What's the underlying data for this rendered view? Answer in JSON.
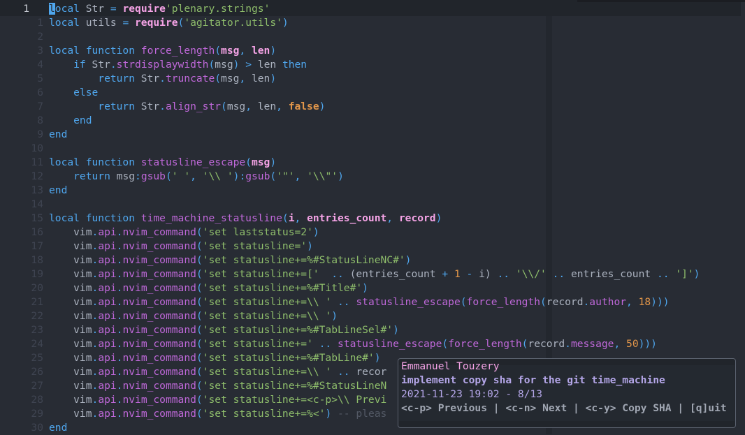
{
  "editor": {
    "cursor_line_number": "1",
    "lines": [
      {
        "num": "1",
        "current": true
      },
      {
        "num": "1"
      },
      {
        "num": "2"
      },
      {
        "num": "3"
      },
      {
        "num": "4"
      },
      {
        "num": "5"
      },
      {
        "num": "6"
      },
      {
        "num": "7"
      },
      {
        "num": "8"
      },
      {
        "num": "9"
      },
      {
        "num": "10"
      },
      {
        "num": "11"
      },
      {
        "num": "12"
      },
      {
        "num": "13"
      },
      {
        "num": "14"
      },
      {
        "num": "15"
      },
      {
        "num": "16"
      },
      {
        "num": "17"
      },
      {
        "num": "18"
      },
      {
        "num": "19"
      },
      {
        "num": "20"
      },
      {
        "num": "21"
      },
      {
        "num": "22"
      },
      {
        "num": "23"
      },
      {
        "num": "24"
      },
      {
        "num": "25"
      },
      {
        "num": "26"
      },
      {
        "num": "27"
      },
      {
        "num": "28"
      },
      {
        "num": "29"
      },
      {
        "num": "30"
      }
    ],
    "code": [
      [
        [
          "cursor",
          "l"
        ],
        [
          "kw",
          "ocal "
        ],
        [
          "id",
          "Str "
        ],
        [
          "op",
          "= "
        ],
        [
          "req",
          "require"
        ],
        [
          "str",
          "'plenary.strings'"
        ]
      ],
      [
        [
          "kw",
          "local "
        ],
        [
          "id",
          "utils "
        ],
        [
          "op",
          "= "
        ],
        [
          "req",
          "require"
        ],
        [
          "punc",
          "("
        ],
        [
          "str",
          "'agitator.utils'"
        ],
        [
          "punc",
          ")"
        ]
      ],
      [],
      [
        [
          "kw",
          "local function "
        ],
        [
          "fn",
          "force_length"
        ],
        [
          "punc",
          "("
        ],
        [
          "param",
          "msg"
        ],
        [
          "punc",
          ", "
        ],
        [
          "param",
          "len"
        ],
        [
          "punc",
          ")"
        ]
      ],
      [
        [
          "kw",
          "    if "
        ],
        [
          "id",
          "Str"
        ],
        [
          "punc",
          "."
        ],
        [
          "fn",
          "strdisplaywidth"
        ],
        [
          "punc",
          "("
        ],
        [
          "id",
          "msg"
        ],
        [
          "punc",
          ") "
        ],
        [
          "op",
          "> "
        ],
        [
          "id",
          "len "
        ],
        [
          "kw",
          "then"
        ]
      ],
      [
        [
          "kw",
          "        return "
        ],
        [
          "id",
          "Str"
        ],
        [
          "punc",
          "."
        ],
        [
          "fn",
          "truncate"
        ],
        [
          "punc",
          "("
        ],
        [
          "id",
          "msg"
        ],
        [
          "punc",
          ", "
        ],
        [
          "id",
          "len"
        ],
        [
          "punc",
          ")"
        ]
      ],
      [
        [
          "kw",
          "    else"
        ]
      ],
      [
        [
          "kw",
          "        return "
        ],
        [
          "id",
          "Str"
        ],
        [
          "punc",
          "."
        ],
        [
          "fn",
          "align_str"
        ],
        [
          "punc",
          "("
        ],
        [
          "id",
          "msg"
        ],
        [
          "punc",
          ", "
        ],
        [
          "id",
          "len"
        ],
        [
          "punc",
          ", "
        ],
        [
          "bool",
          "false"
        ],
        [
          "punc",
          ")"
        ]
      ],
      [
        [
          "kw",
          "    end"
        ]
      ],
      [
        [
          "kw",
          "end"
        ]
      ],
      [],
      [
        [
          "kw",
          "local function "
        ],
        [
          "fn",
          "statusline_escape"
        ],
        [
          "punc",
          "("
        ],
        [
          "param",
          "msg"
        ],
        [
          "punc",
          ")"
        ]
      ],
      [
        [
          "kw",
          "    return "
        ],
        [
          "id",
          "msg"
        ],
        [
          "punc",
          ":"
        ],
        [
          "fn",
          "gsub"
        ],
        [
          "punc",
          "("
        ],
        [
          "str",
          "' '"
        ],
        [
          "punc",
          ", "
        ],
        [
          "str",
          "'\\\\ '"
        ],
        [
          "punc",
          ")"
        ],
        [
          "punc",
          ":"
        ],
        [
          "fn",
          "gsub"
        ],
        [
          "punc",
          "("
        ],
        [
          "str",
          "'\"'"
        ],
        [
          "punc",
          ", "
        ],
        [
          "str",
          "'\\\\\"'"
        ],
        [
          "punc",
          ")"
        ]
      ],
      [
        [
          "kw",
          "end"
        ]
      ],
      [],
      [
        [
          "kw",
          "local function "
        ],
        [
          "fn",
          "time_machine_statusline"
        ],
        [
          "punc",
          "("
        ],
        [
          "param",
          "i"
        ],
        [
          "punc",
          ", "
        ],
        [
          "param",
          "entries_count"
        ],
        [
          "punc",
          ", "
        ],
        [
          "param",
          "record"
        ],
        [
          "punc",
          ")"
        ]
      ],
      [
        [
          "id",
          "    vim"
        ],
        [
          "punc",
          "."
        ],
        [
          "fn",
          "api"
        ],
        [
          "punc",
          "."
        ],
        [
          "fn",
          "nvim_command"
        ],
        [
          "punc",
          "("
        ],
        [
          "str",
          "'set laststatus=2'"
        ],
        [
          "punc",
          ")"
        ]
      ],
      [
        [
          "id",
          "    vim"
        ],
        [
          "punc",
          "."
        ],
        [
          "fn",
          "api"
        ],
        [
          "punc",
          "."
        ],
        [
          "fn",
          "nvim_command"
        ],
        [
          "punc",
          "("
        ],
        [
          "str",
          "'set statusline='"
        ],
        [
          "punc",
          ")"
        ]
      ],
      [
        [
          "id",
          "    vim"
        ],
        [
          "punc",
          "."
        ],
        [
          "fn",
          "api"
        ],
        [
          "punc",
          "."
        ],
        [
          "fn",
          "nvim_command"
        ],
        [
          "punc",
          "("
        ],
        [
          "str",
          "'set statusline+=%#StatusLineNC#'"
        ],
        [
          "punc",
          ")"
        ]
      ],
      [
        [
          "id",
          "    vim"
        ],
        [
          "punc",
          "."
        ],
        [
          "fn",
          "api"
        ],
        [
          "punc",
          "."
        ],
        [
          "fn",
          "nvim_command"
        ],
        [
          "punc",
          "("
        ],
        [
          "str",
          "'set statusline+=['"
        ],
        [
          "id",
          "  "
        ],
        [
          "op",
          ".."
        ],
        [
          "id",
          " (entries_count "
        ],
        [
          "op",
          "+ "
        ],
        [
          "num",
          "1 "
        ],
        [
          "op",
          "- "
        ],
        [
          "id",
          "i) "
        ],
        [
          "op",
          ".. "
        ],
        [
          "str",
          "'\\\\/'"
        ],
        [
          "op",
          " .. "
        ],
        [
          "id",
          "entries_count "
        ],
        [
          "op",
          ".. "
        ],
        [
          "str",
          "']'"
        ],
        [
          "punc",
          ")"
        ]
      ],
      [
        [
          "id",
          "    vim"
        ],
        [
          "punc",
          "."
        ],
        [
          "fn",
          "api"
        ],
        [
          "punc",
          "."
        ],
        [
          "fn",
          "nvim_command"
        ],
        [
          "punc",
          "("
        ],
        [
          "str",
          "'set statusline+=%#Title#'"
        ],
        [
          "punc",
          ")"
        ]
      ],
      [
        [
          "id",
          "    vim"
        ],
        [
          "punc",
          "."
        ],
        [
          "fn",
          "api"
        ],
        [
          "punc",
          "."
        ],
        [
          "fn",
          "nvim_command"
        ],
        [
          "punc",
          "("
        ],
        [
          "str",
          "'set statusline+=\\\\ '"
        ],
        [
          "op",
          " .. "
        ],
        [
          "fn",
          "statusline_escape"
        ],
        [
          "punc",
          "("
        ],
        [
          "fn",
          "force_length"
        ],
        [
          "punc",
          "("
        ],
        [
          "id",
          "record"
        ],
        [
          "punc",
          "."
        ],
        [
          "fn",
          "author"
        ],
        [
          "punc",
          ", "
        ],
        [
          "num",
          "18"
        ],
        [
          "punc",
          ")))"
        ]
      ],
      [
        [
          "id",
          "    vim"
        ],
        [
          "punc",
          "."
        ],
        [
          "fn",
          "api"
        ],
        [
          "punc",
          "."
        ],
        [
          "fn",
          "nvim_command"
        ],
        [
          "punc",
          "("
        ],
        [
          "str",
          "'set statusline+=\\\\ '"
        ],
        [
          "punc",
          ")"
        ]
      ],
      [
        [
          "id",
          "    vim"
        ],
        [
          "punc",
          "."
        ],
        [
          "fn",
          "api"
        ],
        [
          "punc",
          "."
        ],
        [
          "fn",
          "nvim_command"
        ],
        [
          "punc",
          "("
        ],
        [
          "str",
          "'set statusline+=%#TabLineSel#'"
        ],
        [
          "punc",
          ")"
        ]
      ],
      [
        [
          "id",
          "    vim"
        ],
        [
          "punc",
          "."
        ],
        [
          "fn",
          "api"
        ],
        [
          "punc",
          "."
        ],
        [
          "fn",
          "nvim_command"
        ],
        [
          "punc",
          "("
        ],
        [
          "str",
          "'set statusline+='"
        ],
        [
          "op",
          " .. "
        ],
        [
          "fn",
          "statusline_escape"
        ],
        [
          "punc",
          "("
        ],
        [
          "fn",
          "force_length"
        ],
        [
          "punc",
          "("
        ],
        [
          "id",
          "record"
        ],
        [
          "punc",
          "."
        ],
        [
          "fn",
          "message"
        ],
        [
          "punc",
          ", "
        ],
        [
          "num",
          "50"
        ],
        [
          "punc",
          ")))"
        ]
      ],
      [
        [
          "id",
          "    vim"
        ],
        [
          "punc",
          "."
        ],
        [
          "fn",
          "api"
        ],
        [
          "punc",
          "."
        ],
        [
          "fn",
          "nvim_command"
        ],
        [
          "punc",
          "("
        ],
        [
          "str",
          "'set statusline+=%#TabLine#'"
        ],
        [
          "punc",
          ")"
        ]
      ],
      [
        [
          "id",
          "    vim"
        ],
        [
          "punc",
          "."
        ],
        [
          "fn",
          "api"
        ],
        [
          "punc",
          "."
        ],
        [
          "fn",
          "nvim_command"
        ],
        [
          "punc",
          "("
        ],
        [
          "str",
          "'set statusline+=\\\\ '"
        ],
        [
          "op",
          " .. "
        ],
        [
          "id",
          "recor"
        ]
      ],
      [
        [
          "id",
          "    vim"
        ],
        [
          "punc",
          "."
        ],
        [
          "fn",
          "api"
        ],
        [
          "punc",
          "."
        ],
        [
          "fn",
          "nvim_command"
        ],
        [
          "punc",
          "("
        ],
        [
          "str",
          "'set statusline+=%#StatusLineN"
        ]
      ],
      [
        [
          "id",
          "    vim"
        ],
        [
          "punc",
          "."
        ],
        [
          "fn",
          "api"
        ],
        [
          "punc",
          "."
        ],
        [
          "fn",
          "nvim_command"
        ],
        [
          "punc",
          "("
        ],
        [
          "str",
          "'set statusline+=<c-p>\\\\ Previ"
        ]
      ],
      [
        [
          "id",
          "    vim"
        ],
        [
          "punc",
          "."
        ],
        [
          "fn",
          "api"
        ],
        [
          "punc",
          "."
        ],
        [
          "fn",
          "nvim_command"
        ],
        [
          "punc",
          "("
        ],
        [
          "str",
          "'set statusline+=%<'"
        ],
        [
          "punc",
          ")"
        ],
        [
          "cm",
          " -- pleas"
        ]
      ],
      [
        [
          "kw",
          "end"
        ]
      ]
    ]
  },
  "popup": {
    "author": "Emmanuel Touzery",
    "message": "implement copy sha for the git time_machine",
    "date_position": "2021-11-23 19:02 - 8/13",
    "help": "<c-p> Previous | <c-n> Next | <c-y> Copy SHA | [q]uit",
    "keys": [
      {
        "key": "<c-p>",
        "action": "Previous"
      },
      {
        "key": "<c-n>",
        "action": "Next"
      },
      {
        "key": "<c-y>",
        "action": "Copy SHA"
      },
      {
        "key": "[q]",
        "action": "uit"
      }
    ]
  },
  "colors": {
    "background": "#282c34",
    "keyword": "#4fa6ed",
    "function": "#bf68d9",
    "string": "#8ebd6b",
    "number": "#e2964a",
    "author": "#f5a3e6",
    "commit_message": "#b4a6e8"
  }
}
